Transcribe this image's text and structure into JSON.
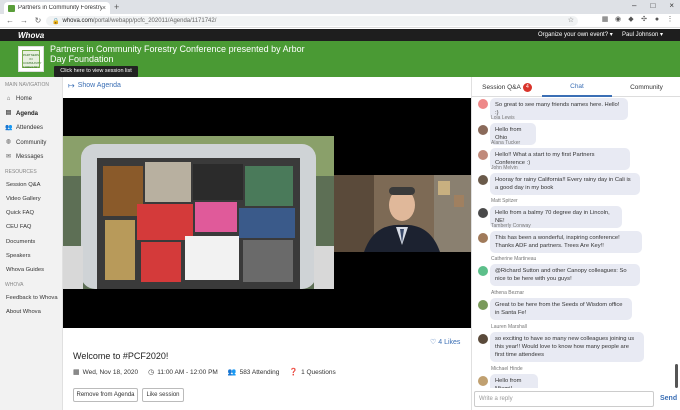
{
  "browser": {
    "tab_title": "Partners in Community Forestry Conference",
    "new_tab": "+",
    "url_host": "whova.com",
    "url_path": "/portal/webapp/pcfc_202011/Agenda/1171742/"
  },
  "topbar": {
    "logo": "Whova",
    "organize": "Organize your own event?",
    "user": "Paul Johnson"
  },
  "header": {
    "title": "Partners in Community Forestry Conference presented by Arbor Day Foundation",
    "tooltip": "Click here to view session list",
    "event_logo_text": "PARTNERS IN COMMUNITY FORESTRY"
  },
  "sidebar": {
    "nav_heading": "MAIN NAVIGATION",
    "nav_items": [
      {
        "label": "Home",
        "icon": "home-icon"
      },
      {
        "label": "Agenda",
        "icon": "agenda-icon"
      },
      {
        "label": "Attendees",
        "icon": "attendees-icon"
      },
      {
        "label": "Community",
        "icon": "community-icon"
      },
      {
        "label": "Messages",
        "icon": "messages-icon"
      }
    ],
    "resources_heading": "RESOURCES",
    "resources": [
      "Session Q&A",
      "Video Gallery",
      "Quick FAQ",
      "CEU FAQ",
      "Documents",
      "Speakers",
      "Whova Guides"
    ],
    "whova_heading": "WHOVA",
    "whova_items": [
      "Feedback to Whova",
      "About Whova"
    ]
  },
  "main": {
    "show_agenda": "Show Agenda",
    "likes": "4 Likes",
    "session_title": "Welcome to #PCF2020!",
    "date": "Wed, Nov 18, 2020",
    "time": "11:00 AM - 12:00 PM",
    "attending": "583 Attending",
    "questions": "1 Questions",
    "remove_label": "Remove from Agenda",
    "like_label": "Like session"
  },
  "panel": {
    "tab_qa": "Session Q&A",
    "qa_badge": "4",
    "tab_chat": "Chat",
    "tab_community": "Community",
    "reply_placeholder": "Write a reply",
    "send": "Send",
    "messages": [
      {
        "name": "",
        "text": "So great to see many friends names here. Hello! :)"
      },
      {
        "name": "Lola Lewis",
        "text": "Hello from Ohio"
      },
      {
        "name": "Alana Tucker",
        "text": "Hello!! What a start to my first Partners Conference :)"
      },
      {
        "name": "John Melvin",
        "text": "Hooray for rainy California!! Every rainy day in Cali is a good day in my book"
      },
      {
        "name": "Matt Spitzer",
        "text": "Hello from a balmy 70 degree day in Lincoln, NE!"
      },
      {
        "name": "Tamberly Conway",
        "text": "This has been a wonderful, inspiring conference! Thanks ADF and partners. Trees Are Key!!"
      },
      {
        "name": "Catherine Martineau",
        "text": "@Richard Sutton and other Canopy colleagues: So nice to be here with you guys!"
      },
      {
        "name": "Athena Beznar",
        "text": "Great to be here from the Seeds of Wisdom office in Santa Fe!"
      },
      {
        "name": "Lauren Marshall",
        "text": "so exciting to have so many new colleagues joining us this year!! Would love to know how many people are first time attendees"
      },
      {
        "name": "Michael Hinde",
        "text": "Hello from Miami!"
      }
    ]
  },
  "colors": {
    "green": "#4a9a34",
    "accent": "#3b6fb5",
    "badge": "#d9342b",
    "bubble": "#e8eaf3"
  }
}
